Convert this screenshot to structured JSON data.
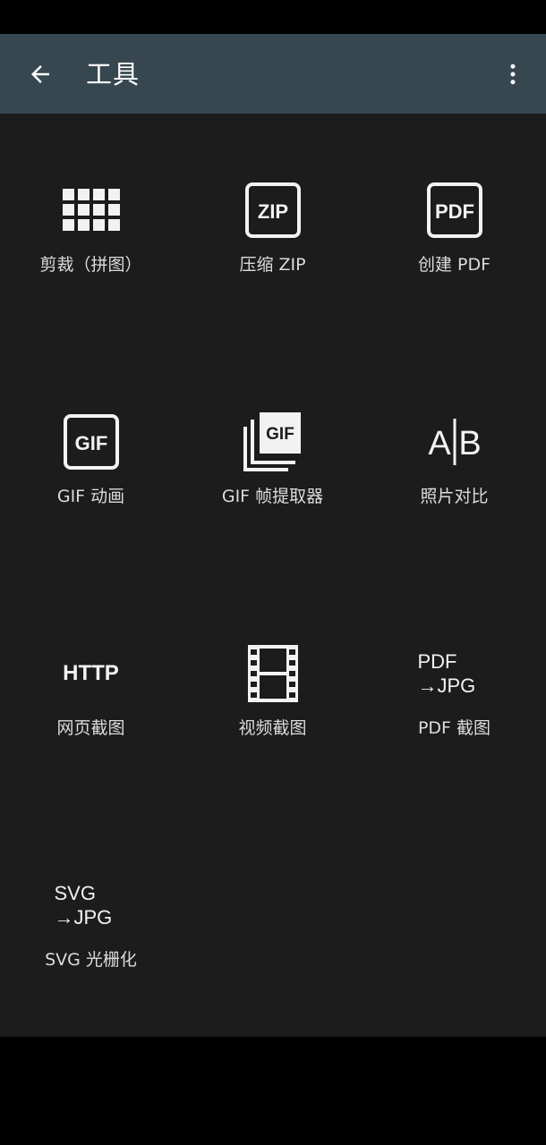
{
  "app_bar": {
    "title": "工具",
    "background": "#37474f",
    "back_icon": "arrow-left-icon",
    "menu_icon": "more-vert-icon"
  },
  "content_background": "#1c1c1c",
  "tools": [
    {
      "id": "crop",
      "label": "剪裁（拼图）",
      "icon": "grid-icon"
    },
    {
      "id": "zip",
      "label": "压缩 ZIP",
      "icon": "zip-icon",
      "icon_text": "ZIP"
    },
    {
      "id": "pdf",
      "label": "创建 PDF",
      "icon": "pdf-icon",
      "icon_text": "PDF"
    },
    {
      "id": "gif",
      "label": "GIF 动画",
      "icon": "gif-icon",
      "icon_text": "GIF"
    },
    {
      "id": "gif-frames",
      "label": "GIF 帧提取器",
      "icon": "gif-stack-icon",
      "icon_text": "GIF"
    },
    {
      "id": "compare",
      "label": "照片对比",
      "icon": "compare-icon",
      "icon_text_a": "A",
      "icon_text_b": "B"
    },
    {
      "id": "web",
      "label": "网页截图",
      "icon": "http-icon",
      "icon_text": "HTTP"
    },
    {
      "id": "video",
      "label": "视频截图",
      "icon": "film-icon"
    },
    {
      "id": "pdf-jpg",
      "label": "PDF 截图",
      "icon": "pdf-to-jpg-icon",
      "icon_line1": "PDF",
      "icon_line2": "→JPG"
    },
    {
      "id": "svg-jpg",
      "label": "SVG 光栅化",
      "icon": "svg-to-jpg-icon",
      "icon_line1": "SVG",
      "icon_line2": "→JPG"
    }
  ]
}
